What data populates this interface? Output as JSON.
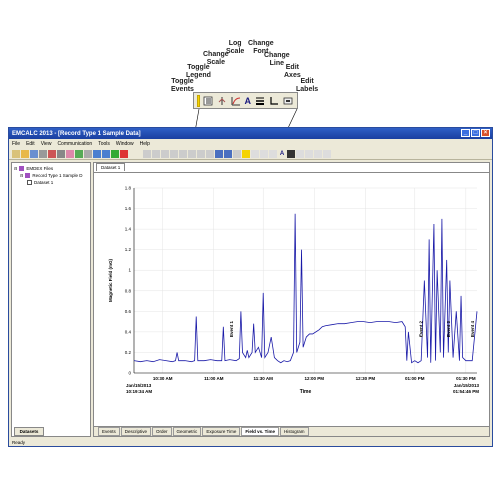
{
  "callouts": {
    "labels": [
      "Log\nScale",
      "Change\nFont",
      "Change\nScale",
      "Change\nLine",
      "Toggle\nLegend",
      "Edit\nAxes",
      "Toggle\nEvents",
      "Edit\nLabels"
    ],
    "toolbar_icons": [
      "toggle-events-icon",
      "toggle-legend-icon",
      "change-scale-icon",
      "log-scale-icon",
      "change-font-icon",
      "change-line-icon",
      "edit-axes-icon",
      "edit-labels-icon"
    ],
    "font_glyph": "A"
  },
  "window": {
    "title": "EMCALC 2013 - [Record Type 1 Sample Data]",
    "menu": [
      "File",
      "Edit",
      "View",
      "Communication",
      "Tools",
      "Window",
      "Help"
    ]
  },
  "tree": {
    "root": "EMDEX Files",
    "child": "Record Type 1 Sample D",
    "leaf": "Dataset 1"
  },
  "left_tab": "Datasets",
  "doc_tab": "Dataset 1",
  "bottom_tabs": [
    "Events",
    "Descriptive",
    "Order",
    "Geometric",
    "Exposure Time",
    "Field vs. Time",
    "Histogram"
  ],
  "active_tab": "Field vs. Time",
  "status": "Ready",
  "colors": {
    "series": "#1a1aa8",
    "titlebar": "#1a3fa0"
  },
  "chart_data": {
    "type": "line",
    "xlabel": "Time",
    "ylabel": "Magnetic Field (mG)",
    "ylim": [
      0,
      1.8
    ],
    "yticks": [
      "0",
      "0.2",
      "0.4",
      "0.6",
      "0.8",
      "1",
      "1.2",
      "1.4",
      "1.6",
      "1.8"
    ],
    "xticks": [
      "10:30 AM",
      "11:00 AM",
      "11:30 AM",
      "12:00 PM",
      "12:30 PM",
      "01:00 PM",
      "01:30 PM"
    ],
    "start_label": [
      "Jan/15/2013",
      "10:19:34 AM"
    ],
    "end_label": [
      "Jan/15/2013",
      "01:54:46 PM"
    ],
    "events": [
      "Event 1",
      "Event 2",
      "Event 3",
      "Event 4"
    ],
    "series": [
      {
        "x": [
          0,
          4,
          8,
          12,
          16,
          20,
          24,
          26,
          27,
          28,
          32,
          36,
          38,
          39,
          40,
          44,
          48,
          52,
          55,
          56,
          57,
          60,
          64,
          66,
          67,
          68,
          70,
          71,
          72,
          74,
          75,
          76,
          78,
          80,
          81,
          82,
          84,
          86,
          88,
          90,
          92,
          94,
          96,
          98,
          100,
          101,
          102,
          104,
          105,
          106,
          108,
          110,
          112,
          114,
          116,
          118,
          120,
          124,
          128,
          132,
          136,
          140,
          144,
          148,
          152,
          156,
          160,
          164,
          168,
          170,
          171,
          172,
          174,
          176,
          178,
          180,
          182,
          184,
          185,
          186,
          188,
          189,
          190,
          192,
          193,
          194,
          196,
          197,
          198,
          200,
          202,
          204,
          205,
          206,
          208,
          212,
          215
        ],
        "y": [
          0.12,
          0.11,
          0.12,
          0.11,
          0.13,
          0.12,
          0.11,
          0.12,
          0.2,
          0.12,
          0.12,
          0.11,
          0.12,
          0.55,
          0.12,
          0.12,
          0.13,
          0.12,
          0.12,
          0.45,
          0.12,
          0.13,
          0.12,
          0.14,
          0.6,
          0.2,
          0.15,
          0.22,
          0.15,
          0.2,
          0.48,
          0.2,
          0.25,
          0.15,
          0.78,
          0.15,
          0.2,
          0.35,
          0.15,
          0.12,
          0.1,
          0.12,
          0.11,
          0.12,
          0.2,
          1.55,
          0.2,
          0.3,
          1.2,
          0.25,
          0.35,
          0.38,
          0.38,
          0.4,
          0.42,
          0.45,
          0.46,
          0.47,
          0.48,
          0.48,
          0.49,
          0.5,
          0.5,
          0.49,
          0.5,
          0.5,
          0.5,
          0.49,
          0.5,
          0.45,
          0.12,
          0.4,
          0.1,
          0.12,
          0.1,
          0.12,
          0.9,
          0.15,
          1.3,
          0.1,
          1.45,
          0.12,
          1.0,
          0.2,
          1.5,
          0.15,
          1.1,
          0.2,
          0.9,
          0.15,
          0.6,
          0.12,
          0.75,
          0.15,
          0.12,
          0.12,
          0.6
        ]
      }
    ]
  }
}
